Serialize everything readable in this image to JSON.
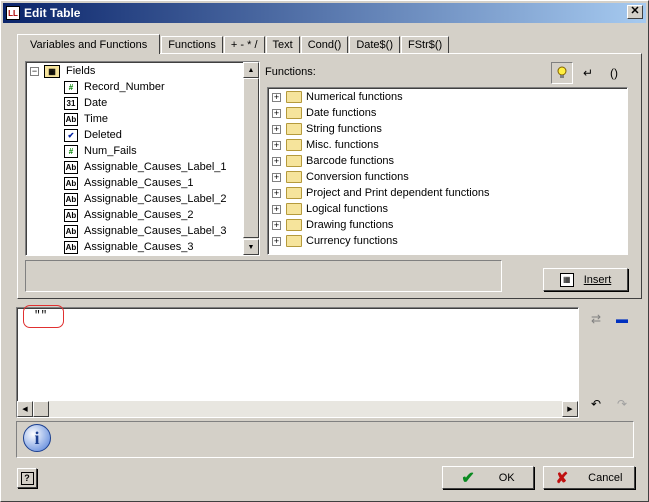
{
  "window": {
    "title": "Edit Table"
  },
  "tabs": [
    "Variables and Functions",
    "Functions",
    "+ - * /",
    "Text",
    "Cond()",
    "Date$()",
    "FStr$()"
  ],
  "fields_tree": {
    "root": "Fields",
    "items": [
      {
        "label": "Record_Number",
        "icon": "#"
      },
      {
        "label": "Date",
        "icon": "31"
      },
      {
        "label": "Time",
        "icon": "Ab"
      },
      {
        "label": "Deleted",
        "icon": "check"
      },
      {
        "label": "Num_Fails",
        "icon": "#"
      },
      {
        "label": "Assignable_Causes_Label_1",
        "icon": "Ab"
      },
      {
        "label": "Assignable_Causes_1",
        "icon": "Ab"
      },
      {
        "label": "Assignable_Causes_Label_2",
        "icon": "Ab"
      },
      {
        "label": "Assignable_Causes_2",
        "icon": "Ab"
      },
      {
        "label": "Assignable_Causes_Label_3",
        "icon": "Ab"
      },
      {
        "label": "Assignable_Causes_3",
        "icon": "Ab"
      }
    ]
  },
  "functions": {
    "label": "Functions:",
    "items": [
      "Numerical functions",
      "Date functions",
      "String functions",
      "Misc. functions",
      "Barcode functions",
      "Conversion functions",
      "Project and Print dependent functions",
      "Logical functions",
      "Drawing functions",
      "Currency functions"
    ]
  },
  "insert_label": "Insert",
  "editor": {
    "content": "\"\""
  },
  "ok_label": "OK",
  "cancel_label": "Cancel",
  "colors": {
    "title_start": "#0a246a",
    "title_end": "#a6caf0",
    "highlight": "#e03030"
  }
}
